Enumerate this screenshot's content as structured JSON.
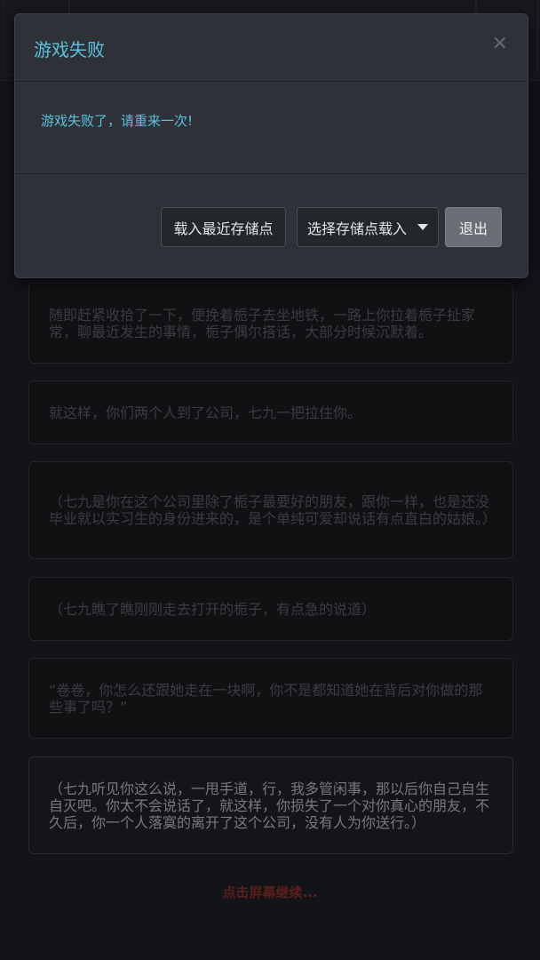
{
  "story": {
    "paragraphs": [
      "随即赶紧收拾了一下，便挽着栀子去坐地铁，一路上你拉着栀子扯家常，聊最近发生的事情，栀子偶尔搭话，大部分时候沉默着。",
      "就这样，你们两个人到了公司，七九一把拉住你。",
      "（七九是你在这个公司里除了栀子最要好的朋友，跟你一样，也是还没毕业就以实习生的身份进来的，是个单纯可爱却说话有点直白的姑娘。）",
      "（七九瞧了瞧刚刚走去打开的栀子，有点急的说道）",
      "“卷卷，你怎么还跟她走在一块啊，你不是都知道她在背后对你做的那些事了吗？”",
      "（七九听见你这么说，一甩手道，行，我多管闲事，那以后你自己自生自灭吧。你太不会说话了，就这样，你损失了一个对你真心的朋友，不久后，你一个人落寞的离开了这个公司，没有人为你送行。）"
    ],
    "continue_hint": "点击屏幕继续..."
  },
  "modal": {
    "title": "游戏失败",
    "close_glyph": "×",
    "message": "游戏失败了，请重来一次!",
    "buttons": {
      "load_recent": "载入最近存储点",
      "choose_save": "选择存储点载入",
      "exit": "退出"
    }
  },
  "colors": {
    "accent": "#5bc0de",
    "continue_hint": "#7a2a25",
    "modal_bg": "#2e3238"
  }
}
